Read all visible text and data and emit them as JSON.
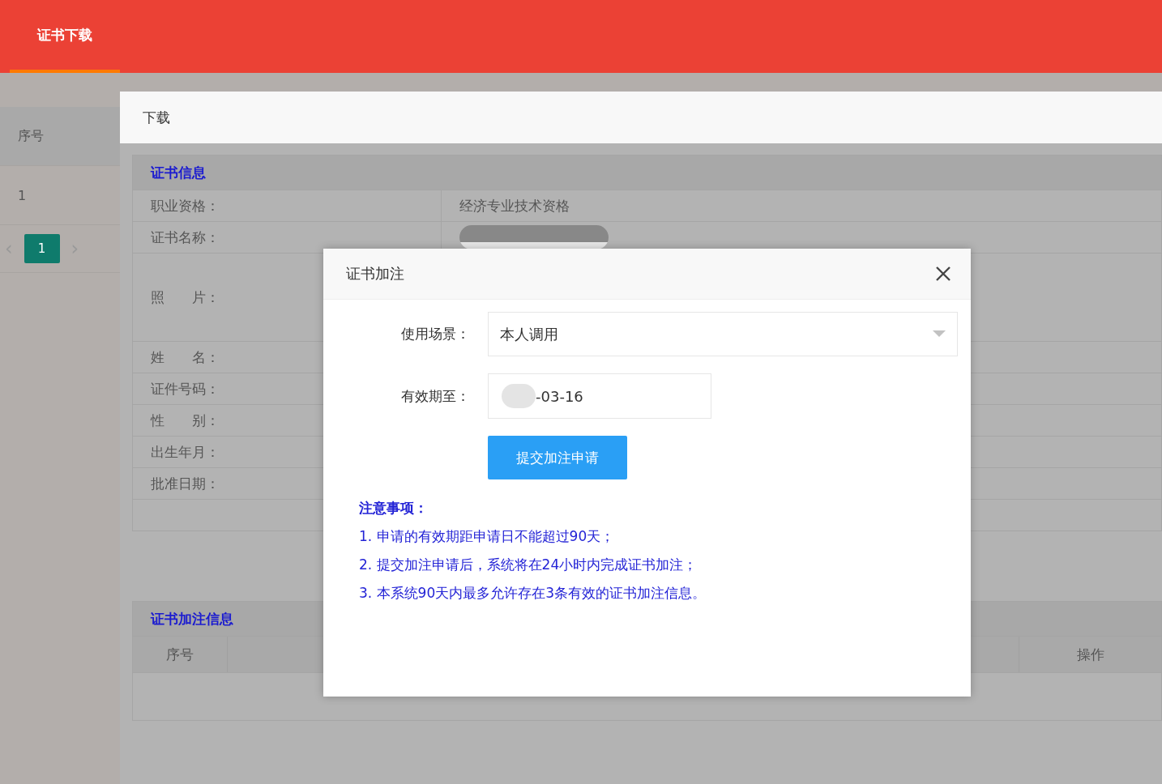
{
  "header": {
    "tabs": [
      {
        "label": "证书下载",
        "selected": true
      }
    ]
  },
  "list": {
    "columns": [
      "序号"
    ],
    "rows": [
      [
        "1"
      ]
    ],
    "pagination": {
      "prev": "‹",
      "next": "›",
      "pages": [
        {
          "label": "1",
          "selected": true
        }
      ]
    }
  },
  "download_dialog": {
    "title": "下载",
    "cert_info": {
      "title": "证书信息",
      "rows": [
        {
          "kind": "text",
          "label": "职业资格：",
          "value": "经济专业技术资格"
        },
        {
          "kind": "redacted",
          "label": "证书名称："
        },
        {
          "kind": "photo",
          "label": "照　　片："
        },
        {
          "kind": "text",
          "label": "姓　　名："
        },
        {
          "kind": "text",
          "label": "证件号码："
        },
        {
          "kind": "text",
          "label": "性　　别："
        },
        {
          "kind": "text",
          "label": "出生年月："
        },
        {
          "kind": "text",
          "label": "批准日期："
        },
        {
          "kind": "empty"
        }
      ]
    },
    "annotation_info": {
      "title": "证书加注信息",
      "columns": [
        "序号",
        "",
        "操作"
      ]
    }
  },
  "annotation_dialog": {
    "title": "证书加注",
    "fields": [
      {
        "kind": "select",
        "label": "使用场景：",
        "value": "本人调用"
      },
      {
        "kind": "date",
        "label": "有效期至：",
        "value": "-03-16",
        "redacted_prefix": true
      }
    ],
    "submit": "提交加注申请",
    "notes_title": "注意事项：",
    "notes": [
      "1. 申请的有效期距申请日不能超过90天；",
      "2. 提交加注申请后，系统将在24小时内完成证书加注；",
      "3. 本系统90天内最多允许存在3条有效的证书加注信息。"
    ]
  }
}
